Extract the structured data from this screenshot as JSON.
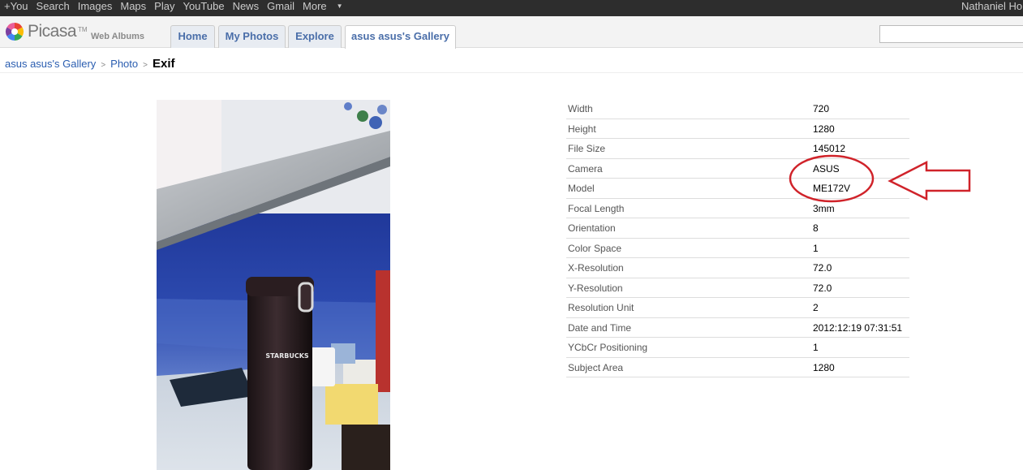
{
  "gbar": {
    "links": [
      "+You",
      "Search",
      "Images",
      "Maps",
      "Play",
      "YouTube",
      "News",
      "Gmail",
      "More"
    ],
    "user": "Nathaniel Hor"
  },
  "header": {
    "logo_text": "Picasa",
    "logo_tm": "TM",
    "logo_sub": "Web Albums",
    "tabs": [
      "Home",
      "My Photos",
      "Explore",
      "asus asus's Gallery"
    ],
    "search_placeholder": ""
  },
  "breadcrumb": {
    "gallery": "asus asus's Gallery",
    "sep": ">",
    "photo": "Photo",
    "current": "Exif"
  },
  "photo": {
    "cup_text": "STARBUCKS"
  },
  "exif": [
    {
      "key": "Width",
      "value": "720"
    },
    {
      "key": "Height",
      "value": "1280"
    },
    {
      "key": "File Size",
      "value": "145012"
    },
    {
      "key": "Camera",
      "value": "ASUS"
    },
    {
      "key": "Model",
      "value": "ME172V"
    },
    {
      "key": "Focal Length",
      "value": "3mm"
    },
    {
      "key": "Orientation",
      "value": "8"
    },
    {
      "key": "Color Space",
      "value": "1"
    },
    {
      "key": "X-Resolution",
      "value": "72.0"
    },
    {
      "key": "Y-Resolution",
      "value": "72.0"
    },
    {
      "key": "Resolution Unit",
      "value": "2"
    },
    {
      "key": "Date and Time",
      "value": "2012:12:19 07:31:51"
    },
    {
      "key": "YCbCr Positioning",
      "value": "1"
    },
    {
      "key": "Subject Area",
      "value": "1280"
    }
  ],
  "colors": {
    "link": "#2a5db0",
    "annotation": "#d0232a"
  }
}
